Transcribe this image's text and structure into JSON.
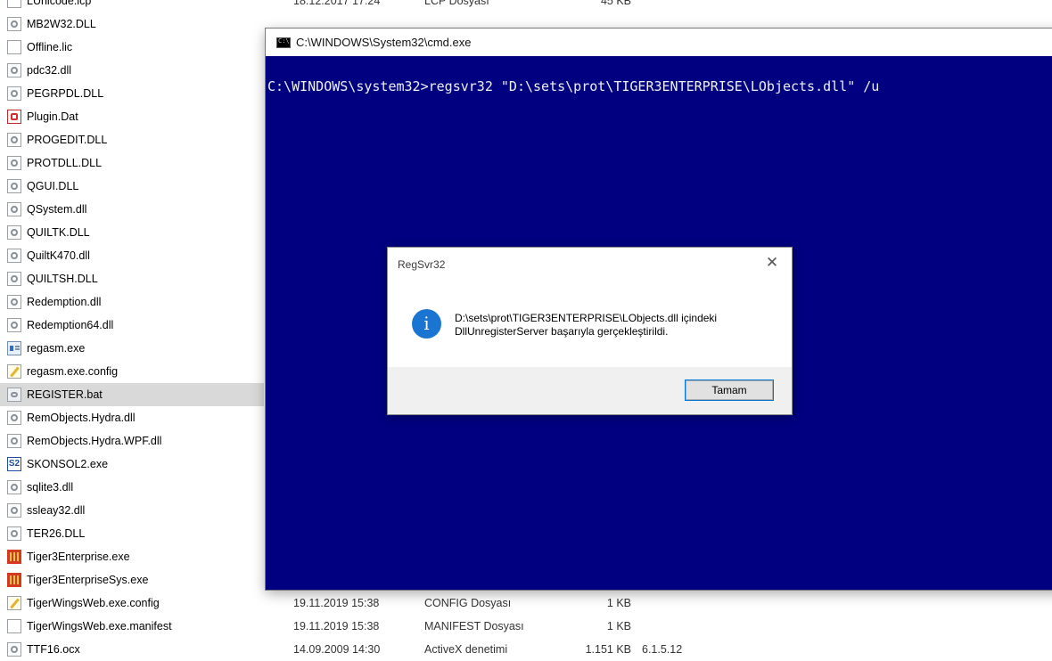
{
  "explorer": {
    "files": [
      {
        "name": "LUnicode.lcp",
        "icon": "doc-icon",
        "date": "18.12.2017 17:24",
        "type": "LCP Dosyası",
        "size": "45 KB",
        "version": ""
      },
      {
        "name": "MB2W32.DLL",
        "icon": "dll-icon",
        "date": "",
        "type": "",
        "size": "",
        "version": ""
      },
      {
        "name": "Offline.lic",
        "icon": "doc-icon",
        "date": "",
        "type": "",
        "size": "",
        "version": ""
      },
      {
        "name": "pdc32.dll",
        "icon": "dll-icon",
        "date": "",
        "type": "",
        "size": "",
        "version": ""
      },
      {
        "name": "PEGRPDL.DLL",
        "icon": "dll-icon",
        "date": "",
        "type": "",
        "size": "",
        "version": ""
      },
      {
        "name": "Plugin.Dat",
        "icon": "pdf-icon",
        "date": "",
        "type": "",
        "size": "",
        "version": ""
      },
      {
        "name": "PROGEDIT.DLL",
        "icon": "dll-icon",
        "date": "",
        "type": "",
        "size": "",
        "version": ""
      },
      {
        "name": "PROTDLL.DLL",
        "icon": "dll-icon",
        "date": "",
        "type": "",
        "size": "",
        "version": ""
      },
      {
        "name": "QGUI.DLL",
        "icon": "dll-icon",
        "date": "",
        "type": "",
        "size": "",
        "version": ""
      },
      {
        "name": "QSystem.dll",
        "icon": "dll-icon",
        "date": "",
        "type": "",
        "size": "",
        "version": ""
      },
      {
        "name": "QUILTK.DLL",
        "icon": "dll-icon",
        "date": "",
        "type": "",
        "size": "",
        "version": ""
      },
      {
        "name": "QuiltK470.dll",
        "icon": "dll-icon",
        "date": "",
        "type": "",
        "size": "",
        "version": ""
      },
      {
        "name": "QUILTSH.DLL",
        "icon": "dll-icon",
        "date": "",
        "type": "",
        "size": "",
        "version": ""
      },
      {
        "name": "Redemption.dll",
        "icon": "dll-icon",
        "date": "",
        "type": "",
        "size": "",
        "version": ""
      },
      {
        "name": "Redemption64.dll",
        "icon": "dll-icon",
        "date": "",
        "type": "",
        "size": "",
        "version": ""
      },
      {
        "name": "regasm.exe",
        "icon": "exe-icon",
        "date": "",
        "type": "",
        "size": "",
        "version": ""
      },
      {
        "name": "regasm.exe.config",
        "icon": "config-icon",
        "date": "",
        "type": "",
        "size": "",
        "version": ""
      },
      {
        "name": "REGISTER.bat",
        "icon": "bat-icon",
        "date": "",
        "type": "",
        "size": "",
        "version": "",
        "selected": true
      },
      {
        "name": "RemObjects.Hydra.dll",
        "icon": "dll-icon",
        "date": "",
        "type": "",
        "size": "",
        "version": ""
      },
      {
        "name": "RemObjects.Hydra.WPF.dll",
        "icon": "dll-icon",
        "date": "",
        "type": "",
        "size": "",
        "version": ""
      },
      {
        "name": "SKONSOL2.exe",
        "icon": "s2-app-icon",
        "date": "",
        "type": "",
        "size": "",
        "version": ""
      },
      {
        "name": "sqlite3.dll",
        "icon": "dll-icon",
        "date": "",
        "type": "",
        "size": "",
        "version": ""
      },
      {
        "name": "ssleay32.dll",
        "icon": "dll-icon",
        "date": "",
        "type": "",
        "size": "",
        "version": ""
      },
      {
        "name": "TER26.DLL",
        "icon": "dll-icon",
        "date": "",
        "type": "",
        "size": "",
        "version": ""
      },
      {
        "name": "Tiger3Enterprise.exe",
        "icon": "tiger-app-icon",
        "date": "",
        "type": "",
        "size": "",
        "version": ""
      },
      {
        "name": "Tiger3EnterpriseSys.exe",
        "icon": "tiger-app-icon",
        "date": "",
        "type": "",
        "size": "",
        "version": ""
      },
      {
        "name": "TigerWingsWeb.exe.config",
        "icon": "config-icon",
        "date": "19.11.2019 15:38",
        "type": "CONFIG Dosyası",
        "size": "1 KB",
        "version": ""
      },
      {
        "name": "TigerWingsWeb.exe.manifest",
        "icon": "doc-icon",
        "date": "19.11.2019 15:38",
        "type": "MANIFEST Dosyası",
        "size": "1 KB",
        "version": ""
      },
      {
        "name": "TTF16.ocx",
        "icon": "dll-icon",
        "date": "14.09.2009 14:30",
        "type": "ActiveX denetimi",
        "size": "1.151 KB",
        "version": "6.1.5.12"
      }
    ]
  },
  "cmd": {
    "title": "C:\\WINDOWS\\System32\\cmd.exe",
    "command_line": "C:\\WINDOWS\\system32>regsvr32 \"D:\\sets\\prot\\TIGER3ENTERPRISE\\LObjects.dll\" /u"
  },
  "dialog": {
    "title": "RegSvr32",
    "close_glyph": "✕",
    "info_glyph": "i",
    "message_line1": "D:\\sets\\prot\\TIGER3ENTERPRISE\\LObjects.dll içindeki",
    "message_line2": "DllUnregisterServer başarıyla gerçekleştirildi.",
    "ok_label": "Tamam"
  }
}
